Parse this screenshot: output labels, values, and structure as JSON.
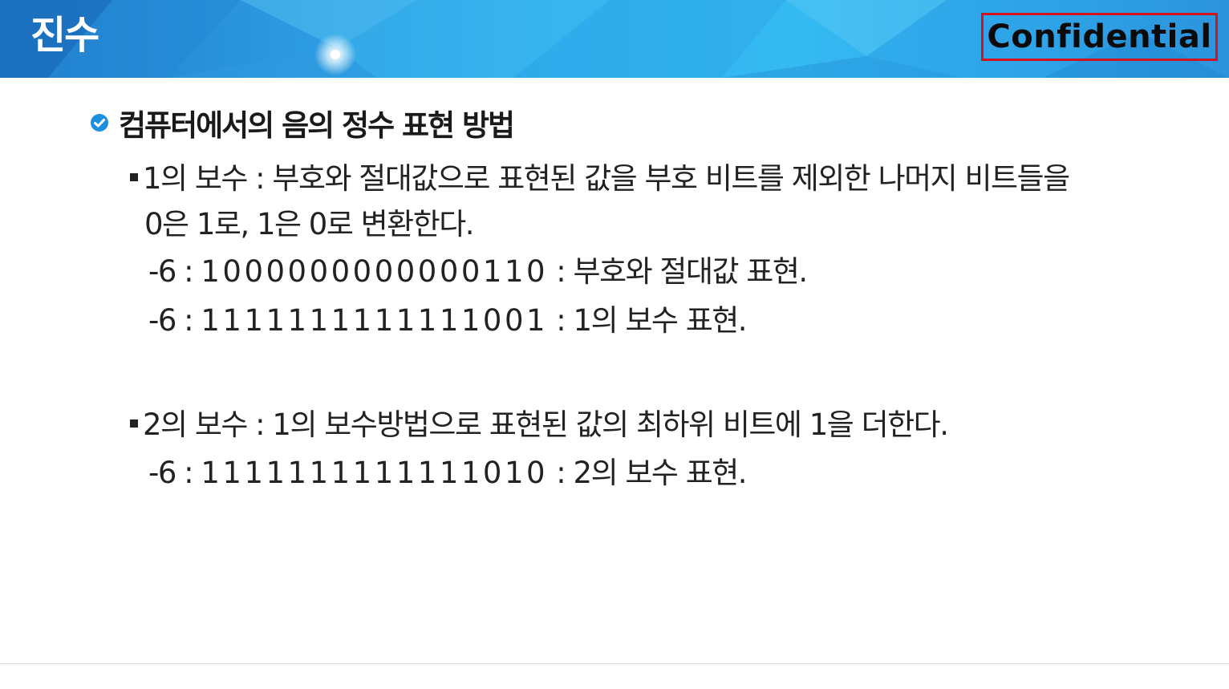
{
  "header": {
    "title": "진수",
    "badge": "Confidential",
    "badge_border_color": "#d4141c"
  },
  "section": {
    "icon": "check-circle-icon",
    "title": "컴퓨터에서의 음의 정수 표현 방법"
  },
  "ones_complement": {
    "line1": "1의 보수 : 부호와 절대값으로 표현된 값을 부호 비트를 제외한 나머지 비트들을",
    "line2": "0은 1로, 1은 0로 변환한다.",
    "example1_prefix": "-6 : ",
    "example1_bits": "1000000000000110",
    "example1_suffix": " : 부호와 절대값 표현.",
    "example2_prefix": "-6 : ",
    "example2_bits": "1111111111111001",
    "example2_suffix": " : 1의 보수 표현."
  },
  "twos_complement": {
    "line1": "2의 보수 : 1의 보수방법으로 표현된 값의 최하위 비트에 1을 더한다.",
    "example_prefix": "-6 : ",
    "example_bits": "1111111111111010",
    "example_suffix": " : 2의 보수 표현."
  }
}
